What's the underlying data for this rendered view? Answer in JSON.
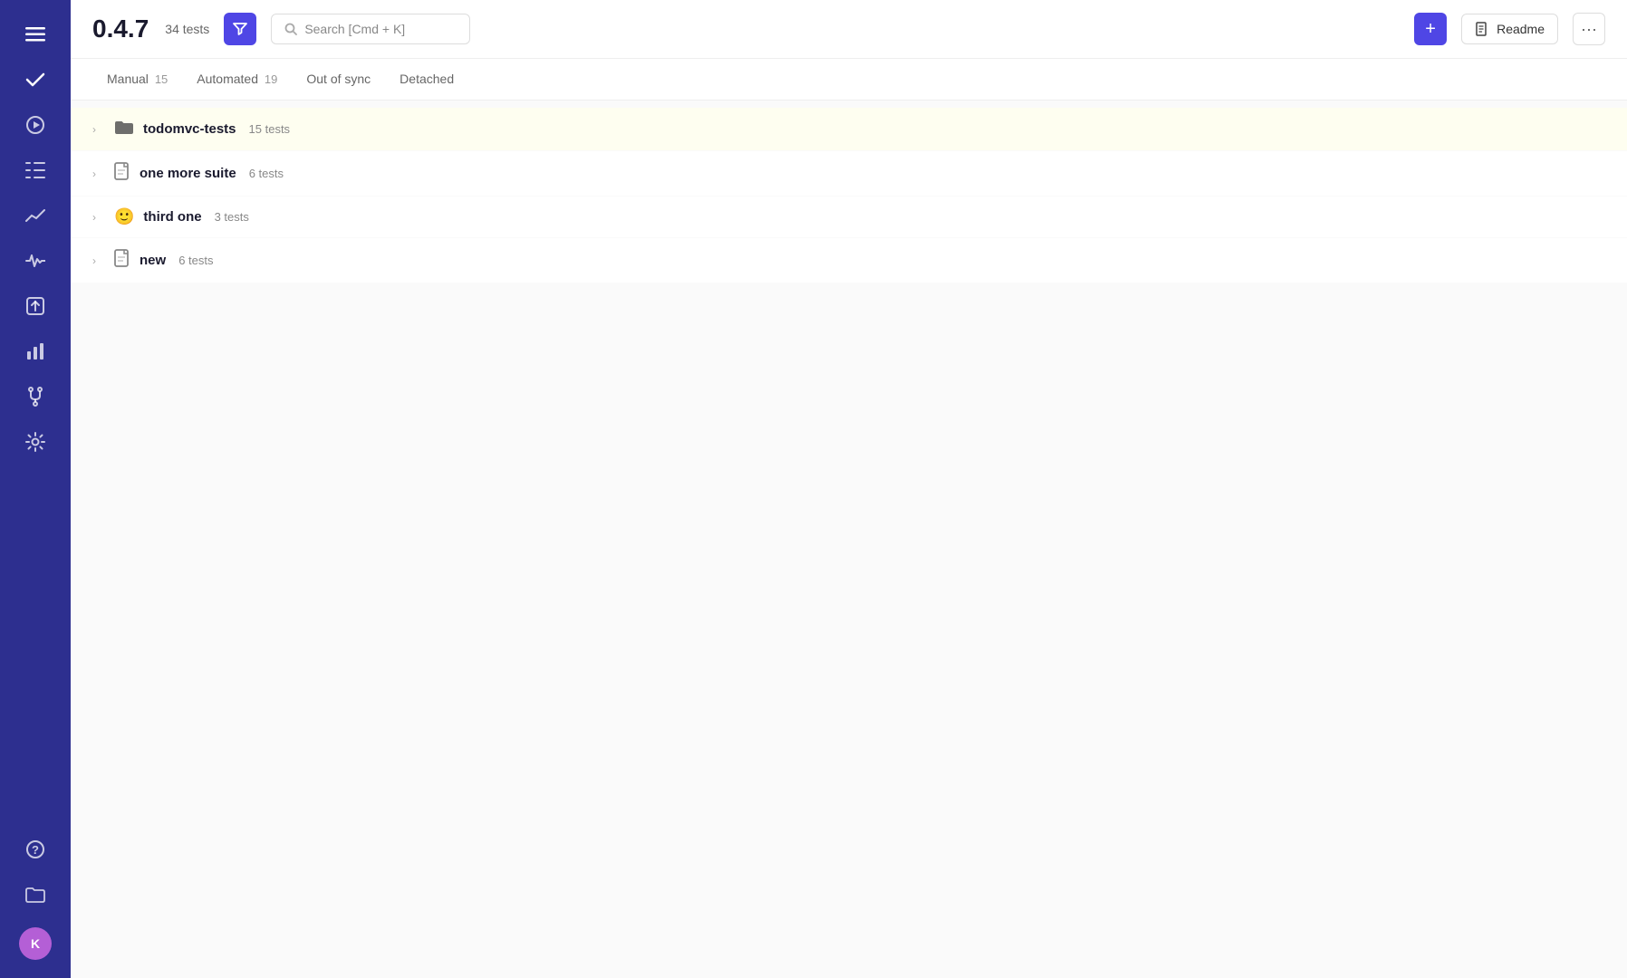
{
  "sidebar": {
    "icons": [
      {
        "name": "menu-icon",
        "symbol": "☰"
      },
      {
        "name": "check-icon",
        "symbol": "✓"
      },
      {
        "name": "play-icon",
        "symbol": "▶"
      },
      {
        "name": "list-icon",
        "symbol": "≡"
      },
      {
        "name": "trending-icon",
        "symbol": "↗"
      },
      {
        "name": "activity-icon",
        "symbol": "⌇"
      },
      {
        "name": "export-icon",
        "symbol": "⇥"
      },
      {
        "name": "chart-icon",
        "symbol": "▦"
      },
      {
        "name": "fork-icon",
        "symbol": "⑂"
      },
      {
        "name": "settings-icon",
        "symbol": "⚙"
      },
      {
        "name": "help-icon",
        "symbol": "?"
      },
      {
        "name": "folder-icon",
        "symbol": "🗂"
      }
    ],
    "avatar_label": "K"
  },
  "header": {
    "version": "0.4.7",
    "test_count": "34 tests",
    "filter_label": "▼",
    "search_placeholder": "Search [Cmd + K]",
    "add_label": "+",
    "readme_label": "Readme",
    "more_label": "···"
  },
  "tabs": [
    {
      "id": "manual",
      "label": "Manual",
      "count": "15"
    },
    {
      "id": "automated",
      "label": "Automated",
      "count": "19"
    },
    {
      "id": "out-of-sync",
      "label": "Out of sync",
      "count": ""
    },
    {
      "id": "detached",
      "label": "Detached",
      "count": ""
    }
  ],
  "suites": [
    {
      "id": "todomvc",
      "icon": "folder",
      "icon_symbol": "📁",
      "name": "todomvc-tests",
      "count": "15 tests",
      "highlighted": true
    },
    {
      "id": "one-more",
      "icon": "file",
      "icon_symbol": "📄",
      "name": "one more suite",
      "count": "6 tests",
      "highlighted": false
    },
    {
      "id": "third-one",
      "icon": "emoji",
      "icon_symbol": "🙂",
      "name": "third one",
      "count": "3 tests",
      "highlighted": false
    },
    {
      "id": "new",
      "icon": "file",
      "icon_symbol": "📄",
      "name": "new",
      "count": "6 tests",
      "highlighted": false
    }
  ],
  "colors": {
    "sidebar_bg": "#2d2f8f",
    "accent": "#4f46e5"
  }
}
